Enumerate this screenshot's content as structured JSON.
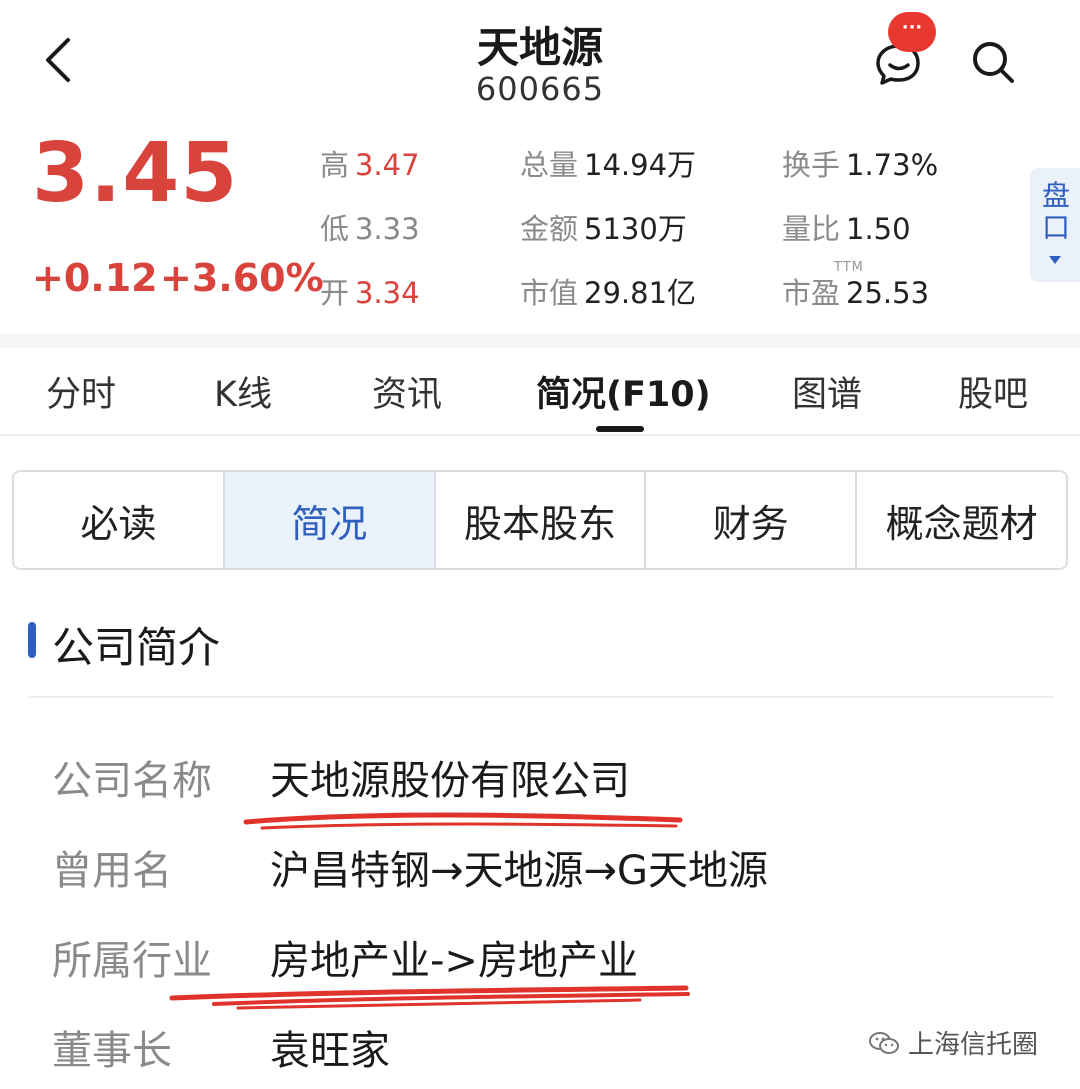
{
  "header": {
    "stock_name": "天地源",
    "stock_code": "600665",
    "chat_badge": "···"
  },
  "quote": {
    "price": "3.45",
    "change": "+0.12",
    "change_pct": "+3.60%",
    "high_label": "高",
    "high": "3.47",
    "low_label": "低",
    "low": "3.33",
    "open_label": "开",
    "open": "3.34",
    "volume_label": "总量",
    "volume": "14.94万",
    "amount_label": "金额",
    "amount": "5130万",
    "mktcap_label": "市值",
    "mktcap": "29.81亿",
    "turnover_label": "换手",
    "turnover": "1.73%",
    "vol_ratio_label": "量比",
    "vol_ratio": "1.50",
    "pe_label": "市盈",
    "pe_tag": "TTM",
    "pe": "25.53",
    "up_color": "#d8433b"
  },
  "side_panel": {
    "label": "盘口"
  },
  "tabs": [
    {
      "label": "分时"
    },
    {
      "label": "K线"
    },
    {
      "label": "资讯"
    },
    {
      "label": "简况(F10)",
      "active": true
    },
    {
      "label": "图谱"
    },
    {
      "label": "股吧"
    }
  ],
  "segments": [
    {
      "label": "必读"
    },
    {
      "label": "简况",
      "active": true
    },
    {
      "label": "股本股东"
    },
    {
      "label": "财务"
    },
    {
      "label": "概念题材"
    }
  ],
  "profile": {
    "title": "公司简介",
    "rows": [
      {
        "label": "公司名称",
        "value": "天地源股份有限公司"
      },
      {
        "label": "曾用名",
        "value": "沪昌特钢→天地源→G天地源"
      },
      {
        "label": "所属行业",
        "value": "房地产业->房地产业"
      },
      {
        "label": "董事长",
        "value": "袁旺家"
      }
    ]
  },
  "watermark": {
    "text": "上海信托圈"
  },
  "accent_color": "#2e5fbe"
}
